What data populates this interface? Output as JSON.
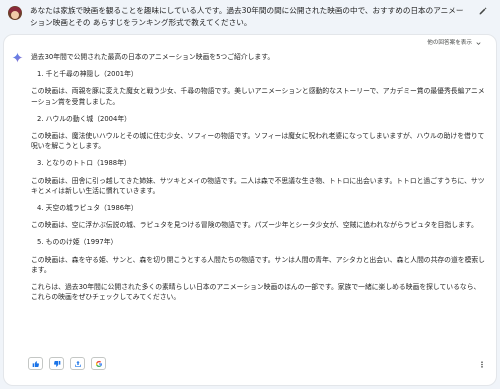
{
  "prompt": {
    "text": "あなたは家族で映画を観ることを趣味にしている人です。過去30年間の間に公開された映画の中で、おすすめの日本のアニメーション映画とその あらすじをランキング形式で教えてください。"
  },
  "response": {
    "drafts_label": "他の回答案を表示",
    "intro": "過去30年間で公開された最高の日本のアニメーション映画を5つご紹介します。",
    "items": [
      {
        "heading": "1. 千と千尋の神隠し（2001年）",
        "summary": "この映画は、両親を豚に変えた魔女と戦う少女、千尋の物語です。美しいアニメーションと感動的なストーリーで、アカデミー賞の最優秀長編アニメーション賞を受賞しました。"
      },
      {
        "heading": "2. ハウルの動く城（2004年）",
        "summary": "この映画は、魔法使いハウルとその城に住む少女、ソフィーの物語です。ソフィーは魔女に呪われ老婆になってしまいますが、ハウルの助けを借りて呪いを解こうとします。"
      },
      {
        "heading": "3. となりのトトロ（1988年）",
        "summary": "この映画は、田舎に引っ越してきた姉妹、サツキとメイの物語です。二人は森で不思議な生き物、トトロに出会います。トトロと過ごすうちに、サツキとメイは新しい生活に慣れていきます。"
      },
      {
        "heading": "4. 天空の城ラピュタ（1986年）",
        "summary": "この映画は、空に浮かぶ伝説の城、ラピュタを見つける冒険の物語です。パズー少年とシータ少女が、空賊に追われながらラピュタを目指します。"
      },
      {
        "heading": "5. もののけ姫（1997年）",
        "summary": "この映画は、森を守る姫、サンと、森を切り開こうとする人間たちの物語です。サンは人間の青年、アシタカと出会い、森と人間の共存の道を模索します。"
      }
    ],
    "closing": "これらは、過去30年間に公開された多くの素晴らしい日本のアニメーション映画のほんの一部です。家族で一緒に楽しめる映画を探しているなら、これらの映画をぜひチェックしてみてください。"
  },
  "actions": {
    "icons": [
      "thumbs-up-icon",
      "thumbs-down-icon",
      "share-icon",
      "google-icon",
      "more-vert-icon"
    ]
  },
  "colors": {
    "page_bg": "#f0f4f9",
    "card_bg": "#ffffff",
    "text": "#1f1f1f",
    "muted": "#444746",
    "gemini_blue": "#4285f4"
  }
}
